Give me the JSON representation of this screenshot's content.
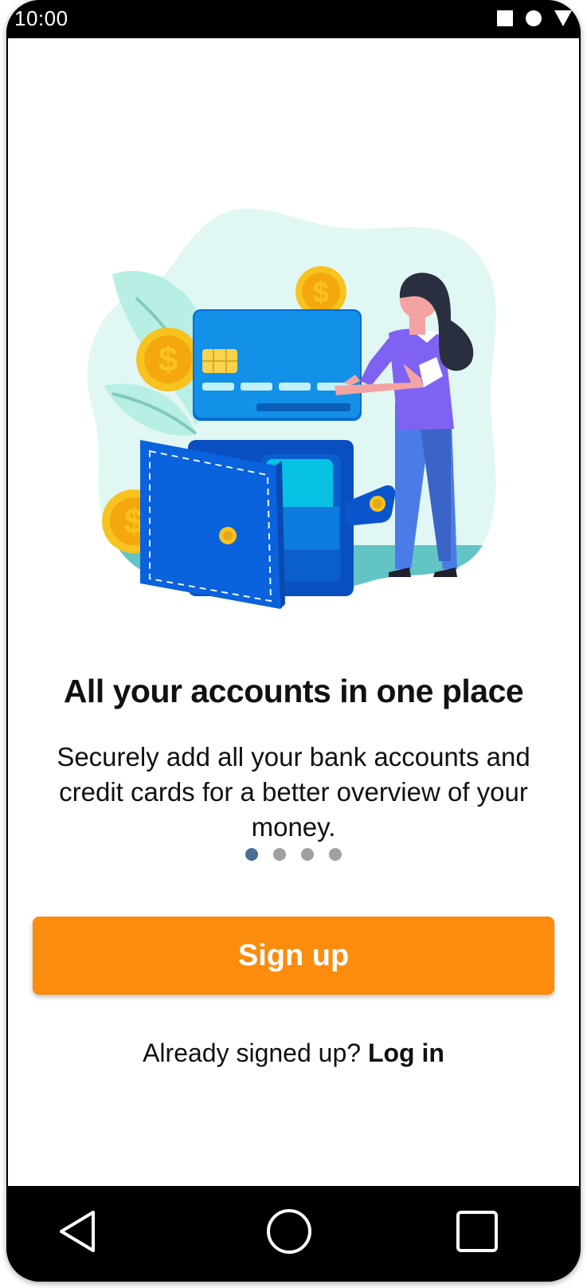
{
  "status_bar": {
    "time": "10:00",
    "icons": [
      "square-icon",
      "circle-icon",
      "signal-triangle-icon"
    ]
  },
  "onboarding": {
    "title": "All your accounts in one place",
    "description": "Securely add all your bank accounts and credit cards for a better overview of your money.",
    "page_indicator": {
      "total": 4,
      "current": 1
    }
  },
  "actions": {
    "signup_label": "Sign up",
    "login_prompt": "Already signed up?",
    "login_label": "Log in"
  },
  "navigation": {
    "icons": [
      "back-triangle-icon",
      "home-circle-icon",
      "recents-square-icon"
    ]
  },
  "colors": {
    "accent": "#FB8C0E",
    "dot_active": "#4A6F95",
    "dot_inactive": "#A0A0A0"
  }
}
